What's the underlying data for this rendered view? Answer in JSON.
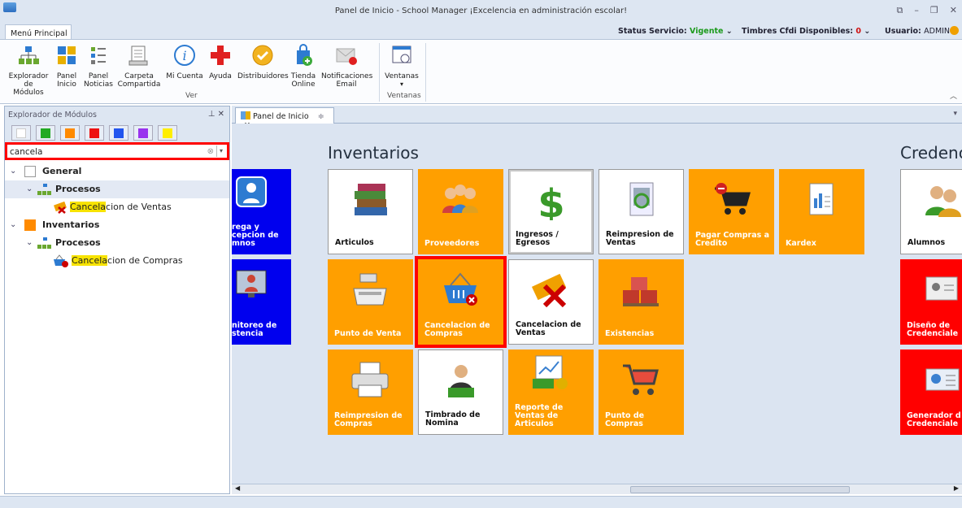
{
  "window": {
    "title": "Panel de Inicio - School Manager ¡Excelencia en administración escolar!"
  },
  "menu_tab": "Menú Principal",
  "status": {
    "service_label": "Status Servicio:",
    "service_value": "Vigente",
    "timbres_label": "Timbres Cfdi Disponibles:",
    "timbres_value": "0",
    "user_label": "Usuario:",
    "user_value": "ADMIN"
  },
  "ribbon": {
    "buttons": [
      {
        "label": "Explorador de Módulos",
        "icon": "module-tree-icon"
      },
      {
        "label": "Panel Inicio",
        "icon": "panel-grid-icon"
      },
      {
        "label": "Panel Noticias",
        "icon": "news-list-icon"
      },
      {
        "label": "Carpeta Compartida",
        "icon": "shared-folder-icon"
      },
      {
        "label": "Mi Cuenta",
        "icon": "info-icon"
      },
      {
        "label": "Ayuda",
        "icon": "help-cross-icon"
      },
      {
        "label": "Distribuidores",
        "icon": "badge-icon"
      },
      {
        "label": "Tienda Online",
        "icon": "store-bag-icon"
      },
      {
        "label": "Notificaciones Email",
        "icon": "email-icon"
      },
      {
        "label": "Ventanas",
        "icon": "windows-icon"
      }
    ],
    "group_ver": "Ver",
    "group_ventanas": "Ventanas"
  },
  "explorer": {
    "title": "Explorador de Módulos",
    "swatch_colors": [
      "#ffffff",
      "#22aa22",
      "#ff8a00",
      "#ee1111",
      "#2255ee",
      "#9933ee",
      "#ffee00"
    ],
    "search_value": "cancela",
    "tree": [
      {
        "label": "General",
        "type": "category",
        "color": "#ffffff"
      },
      {
        "label": "Procesos",
        "type": "group"
      },
      {
        "label_hl": "Cancela",
        "label_rest": "cion de Ventas",
        "type": "item"
      },
      {
        "label": "Inventarios",
        "type": "category",
        "color": "#ff8a00"
      },
      {
        "label": "Procesos",
        "type": "group"
      },
      {
        "label_hl": "Cancela",
        "label_rest": "cion de Compras",
        "type": "item"
      }
    ]
  },
  "doc_tab": {
    "title": "Panel de Inicio"
  },
  "sections": {
    "left_partial": "",
    "inventarios": "Inventarios",
    "credenciales": "Credenc"
  },
  "tiles": {
    "left": [
      {
        "label": "rega y\ncepcion de\nmnos"
      },
      {
        "label": "nitoreo de\nstencia"
      }
    ],
    "inv": [
      {
        "label": "Articulos"
      },
      {
        "label": "Proveedores"
      },
      {
        "label": "Ingresos /\nEgresos"
      },
      {
        "label": "Reimpresion de\nVentas"
      },
      {
        "label": "Pagar Compras a\nCredito"
      },
      {
        "label": "Kardex"
      },
      {
        "label": "Punto de Venta"
      },
      {
        "label": "Cancelacion de\nCompras"
      },
      {
        "label": "Cancelacion de\nVentas"
      },
      {
        "label": "Existencias"
      },
      {
        "label": "Reimpresion de\nCompras"
      },
      {
        "label": "Timbrado de\nNomina"
      },
      {
        "label": "Reporte de\nVentas de\nArticulos"
      },
      {
        "label": "Punto de\nCompras"
      }
    ],
    "cred": [
      {
        "label": "Alumnos"
      },
      {
        "label": "Diseño de\nCredenciale"
      },
      {
        "label": "Generador d\nCredenciale"
      }
    ]
  }
}
